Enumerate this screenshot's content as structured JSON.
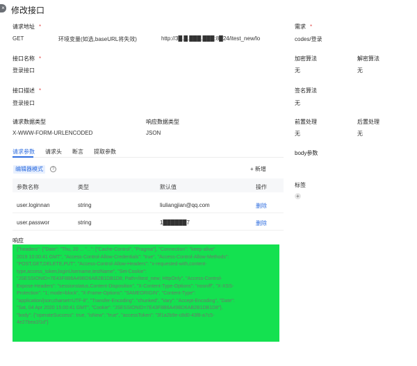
{
  "header": {
    "close_glyph": "×",
    "title": "修改接口"
  },
  "request": {
    "address_label": "请求地址",
    "method": "GET",
    "env_hint": "环境变量(如选,baseURL将失效)",
    "url": "http://3█.█.███.███:8█24/itest_new/lo",
    "name_label": "接口名称",
    "name_value": "登录接口",
    "desc_label": "接口描述",
    "desc_value": "登录接口",
    "req_type_label": "请求数据类型",
    "req_type_value": "X-WWW-FORM-URLENCODED",
    "resp_type_label": "响应数据类型",
    "resp_type_value": "JSON"
  },
  "right": {
    "need_label": "需求",
    "need_value": "codes/登录",
    "encrypt_label": "加密算法",
    "encrypt_value": "无",
    "decrypt_label": "解密算法",
    "decrypt_value": "无",
    "sign_label": "签名算法",
    "sign_value": "无",
    "pre_label": "前置处理",
    "pre_value": "无",
    "post_label": "后置处理",
    "post_value": "无",
    "body_label": "body参数",
    "tag_label": "标签",
    "tag_add_glyph": "+"
  },
  "tabs": [
    "请求参数",
    "请求头",
    "断言",
    "提取参数"
  ],
  "params": {
    "mode_button": "编辑器模式",
    "help_glyph": "?",
    "add_button": "+ 新增",
    "headers": [
      "参数名称",
      "类型",
      "默认值",
      "操作"
    ],
    "rows": [
      {
        "name": "user.loginnan",
        "type": "string",
        "value": "liuliangjian@qq.com",
        "action": "删除"
      },
      {
        "name": "user.passwor",
        "type": "string",
        "value": "1██████7",
        "action": "删除"
      }
    ]
  },
  "response": {
    "label": "响应",
    "lines": [
      "{\"headers\": {\"Date\": \"Thu, 20 ... \"...\": [\"Cache-Control\", \"Pragma\"], \"Connection\": \"keep-alive\"",
      "2019 10:00:41 GMT\", \"Access-Control-Allow-Credentials\": \"true\", \"Access-Control-Allow-Methods\":",
      "\"POST,GET,DELETE,PUT\", \"Access-Control-Allow-Headers\": \"x-requested-with,content-",
      "type,access_token,loginUsername,testName\", \"Set-Cookie\":",
      "\"JSESSIONID=7E43F8B6A49BD6AB2B1DB1D8; Path=/itest_new; HttpOnly\", \"Access-Control-",
      "Expose-Headers\": \"sessionstatus,Content-Disposition\", \"X-Content-Type-Options\": \"nosniff\", \"X-XSS-",
      "Protection\": \"1; mode=block\", \"X-Frame-Options\": \"SAMEORIGIN\", \"Content-Type\":",
      "\"application/json;charset=UTF-8\", \"Transfer-Encoding\": \"chunked\", \"Vary\": \"Accept-Encoding\", \"Date\":",
      "\"Sat, 04 Apr 2020 15:00:41 GMT\", \"Cookie\": \"JSESSIONID=7E43F8B6A49BD6AB2B1DB1D8\"},",
      "\"body\": {\"operateSuccess\": true, \"isNew\": \"true\", \"accessToken\": \"3f1a2b9e-c8d0-43f8-a7c5-",
      "4e27bea1f1d\"}"
    ]
  }
}
